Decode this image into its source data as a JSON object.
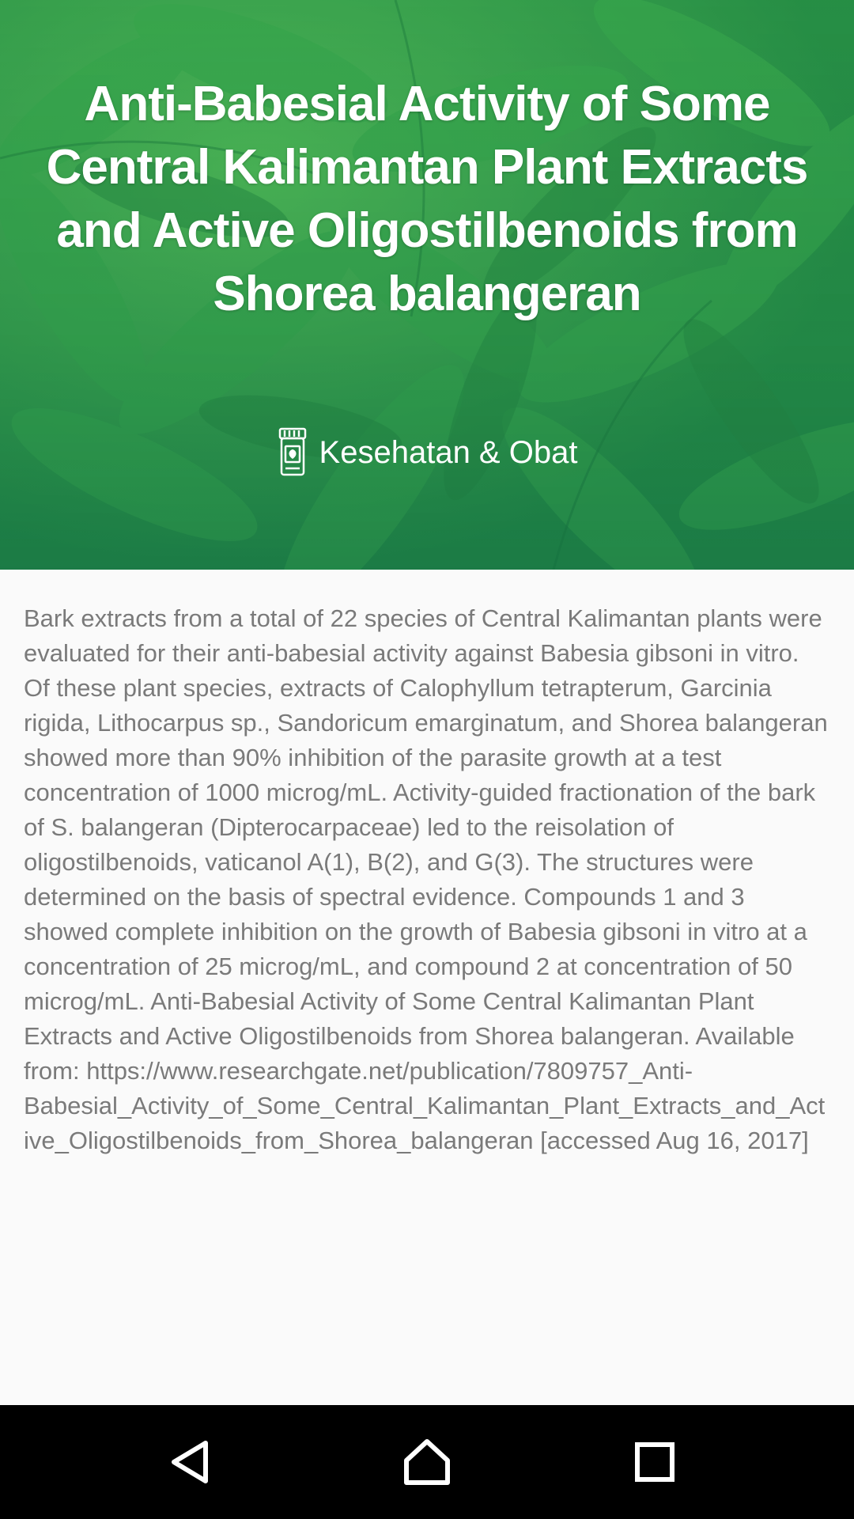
{
  "header": {
    "title": "Anti-Babesial Activity of Some Central Kalimantan Plant Extracts and Active Oligostilbenoids from Shorea balangeran",
    "category_icon": "medicine-jar-icon",
    "category": "Kesehatan & Obat",
    "background": "green-leaves-image"
  },
  "article": {
    "body": "Bark extracts from a total of 22 species of Central Kalimantan plants were evaluated for their anti-babesial activity against Babesia gibsoni in vitro. Of these plant species, extracts of Calophyllum tetrapterum, Garcinia rigida, Lithocarpus sp., Sandoricum emarginatum, and Shorea balangeran showed more than 90% inhibition of the parasite growth at a test concentration of 1000 microg/mL. Activity-guided fractionation of the bark of S. balangeran (Dipterocarpaceae) led to the reisolation of oligostilbenoids, vaticanol A(1), B(2), and G(3). The structures were determined on the basis of spectral evidence. Compounds 1 and 3 showed complete inhibition on the growth of Babesia gibsoni in vitro at a concentration of 25 microg/mL, and compound 2 at concentration of 50 microg/mL. Anti-Babesial Activity of Some Central Kalimantan Plant Extracts and Active Oligostilbenoids from Shorea balangeran. Available from: https://www.researchgate.net/publication/7809757_Anti-Babesial_Activity_of_Some_Central_Kalimantan_Plant_Extracts_and_Active_Oligostilbenoids_from_Shorea_balangeran [accessed Aug 16, 2017]"
  },
  "navbar": {
    "back_icon": "back-triangle-icon",
    "home_icon": "home-icon",
    "recents_icon": "recents-square-icon"
  },
  "colors": {
    "hero_green": "#2f9a46",
    "body_text": "#7a7a7a",
    "background": "#fafafa",
    "navbar": "#000000"
  }
}
